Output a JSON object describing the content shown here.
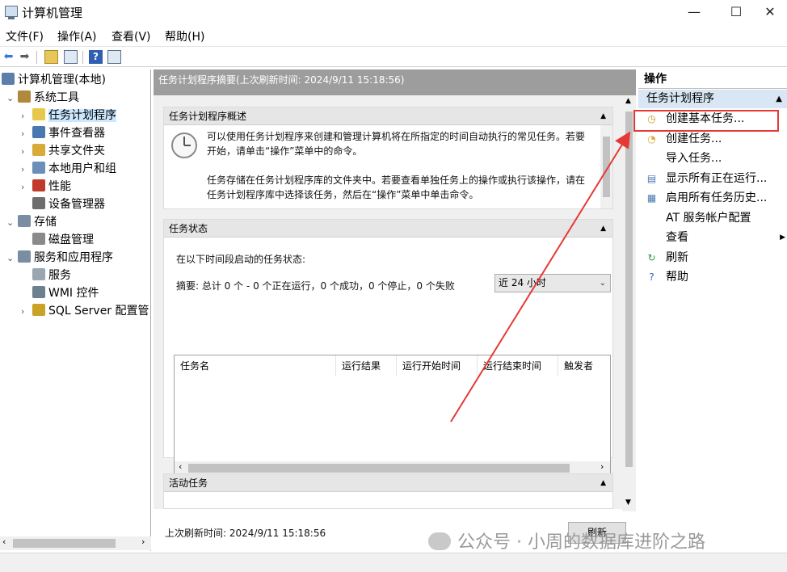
{
  "window": {
    "title": "计算机管理",
    "minimize": "—",
    "maximize": "☐",
    "close": "✕"
  },
  "menu": [
    "文件(F)",
    "操作(A)",
    "查看(V)",
    "帮助(H)"
  ],
  "tree": [
    {
      "label": "计算机管理(本地)",
      "level": 0,
      "expander": "",
      "icon": "computer-icon",
      "color": "#5b7fa8"
    },
    {
      "label": "系统工具",
      "level": 1,
      "expander": "⌄",
      "icon": "tools-icon",
      "color": "#b08a3c"
    },
    {
      "label": "任务计划程序",
      "level": 2,
      "expander": "›",
      "icon": "clock-icon",
      "color": "#e8c84a",
      "selected": true
    },
    {
      "label": "事件查看器",
      "level": 2,
      "expander": "›",
      "icon": "event-viewer-icon",
      "color": "#4a78b0"
    },
    {
      "label": "共享文件夹",
      "level": 2,
      "expander": "›",
      "icon": "shared-folder-icon",
      "color": "#d9a93a"
    },
    {
      "label": "本地用户和组",
      "level": 2,
      "expander": "›",
      "icon": "users-icon",
      "color": "#6a8fb8"
    },
    {
      "label": "性能",
      "level": 2,
      "expander": "›",
      "icon": "performance-icon",
      "color": "#c0392b"
    },
    {
      "label": "设备管理器",
      "level": 2,
      "expander": "",
      "icon": "device-manager-icon",
      "color": "#6e6e6e"
    },
    {
      "label": "存储",
      "level": 1,
      "expander": "⌄",
      "icon": "storage-icon",
      "color": "#7a8da3"
    },
    {
      "label": "磁盘管理",
      "level": 2,
      "expander": "",
      "icon": "disk-icon",
      "color": "#8a8a8a"
    },
    {
      "label": "服务和应用程序",
      "level": 1,
      "expander": "⌄",
      "icon": "services-apps-icon",
      "color": "#7a8da3"
    },
    {
      "label": "服务",
      "level": 2,
      "expander": "",
      "icon": "services-icon",
      "color": "#9aa6b2"
    },
    {
      "label": "WMI 控件",
      "level": 2,
      "expander": "",
      "icon": "wmi-icon",
      "color": "#6e7f90"
    },
    {
      "label": "SQL Server 配置管",
      "level": 2,
      "expander": "›",
      "icon": "sql-server-icon",
      "color": "#c9a227"
    }
  ],
  "center": {
    "header": "任务计划程序摘要(上次刷新时间: 2024/9/11 15:18:56)",
    "overview": {
      "title": "任务计划程序概述",
      "para1_line1": "可以使用任务计划程序来创建和管理计算机将在所指定的时间自动执行的常见任务。若要",
      "para1_line2": "开始，请单击“操作”菜单中的命令。",
      "para2_line1": "任务存储在任务计划程序库的文件夹中。若要查看单独任务上的操作或执行该操作，请在",
      "para2_line2": "任务计划程序库中选择该任务，然后在“操作”菜单中单击命令。"
    },
    "status": {
      "title": "任务状态",
      "label": "在以下时间段启动的任务状态:",
      "range": "近 24 小时",
      "summary": "摘要: 总计 0 个 - 0 个正在运行，0 个成功，0 个停止，0 个失败",
      "columns": [
        "任务名",
        "运行结果",
        "运行开始时间",
        "运行结束时间",
        "触发者"
      ]
    },
    "active": {
      "title": "活动任务"
    },
    "footer": {
      "last_refresh": "上次刷新时间: 2024/9/11 15:18:56",
      "refresh_button": "刷新"
    }
  },
  "actions": {
    "title": "操作",
    "group": "任务计划程序",
    "items": [
      {
        "label": "创建基本任务...",
        "icon": "create-basic-task-icon",
        "glyph": "◷",
        "color": "#c79a2a"
      },
      {
        "label": "创建任务...",
        "icon": "create-task-icon",
        "glyph": "◔",
        "color": "#d9a93a"
      },
      {
        "label": "导入任务...",
        "icon": "",
        "glyph": "",
        "color": ""
      },
      {
        "label": "显示所有正在运行...",
        "icon": "running-tasks-icon",
        "glyph": "▤",
        "color": "#4a78b0"
      },
      {
        "label": "启用所有任务历史...",
        "icon": "task-history-icon",
        "glyph": "▦",
        "color": "#4a78b0"
      },
      {
        "label": "AT 服务帐户配置",
        "icon": "",
        "glyph": "",
        "color": ""
      },
      {
        "label": "查看",
        "icon": "",
        "glyph": "",
        "color": "",
        "submenu": true
      },
      {
        "label": "刷新",
        "icon": "refresh-icon",
        "glyph": "↻",
        "color": "#2e9a3c"
      },
      {
        "label": "帮助",
        "icon": "help-icon",
        "glyph": "?",
        "color": "#2f5fb3"
      }
    ]
  },
  "watermark": "公众号 · 小周的数据库进阶之路",
  "colors": {
    "highlight": "#e53935",
    "arrow": "#e53935",
    "selection": "#cce8ff"
  }
}
